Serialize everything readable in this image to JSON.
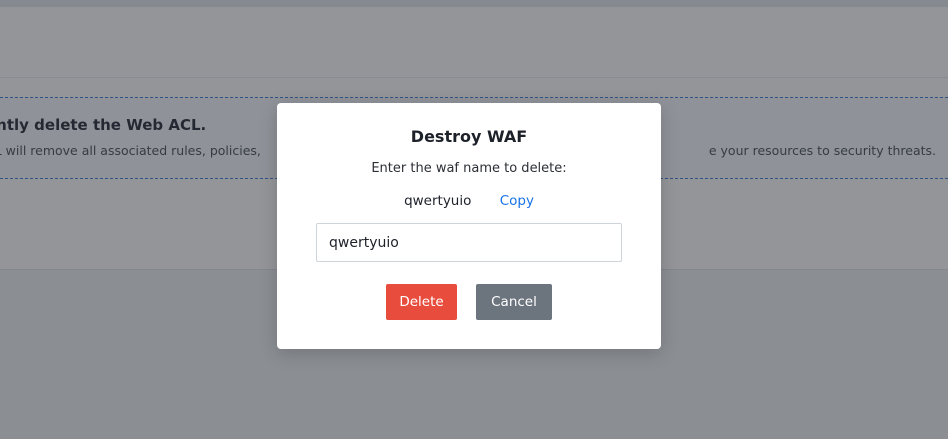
{
  "background": {
    "warning_title": "ently delete the Web ACL.",
    "warning_description_left": "CL will remove all associated rules, policies,",
    "warning_description_right": "e your resources to security threats."
  },
  "modal": {
    "title": "Destroy WAF",
    "prompt": "Enter the waf name to delete:",
    "waf_name": "qwertyuio",
    "copy_label": "Copy",
    "input_value": "qwertyuio",
    "delete_label": "Delete",
    "cancel_label": "Cancel"
  },
  "colors": {
    "delete_button": "#e74c3c",
    "cancel_button": "#6c747e",
    "link": "#1a73e8",
    "warning_border": "#3a7bd5"
  }
}
